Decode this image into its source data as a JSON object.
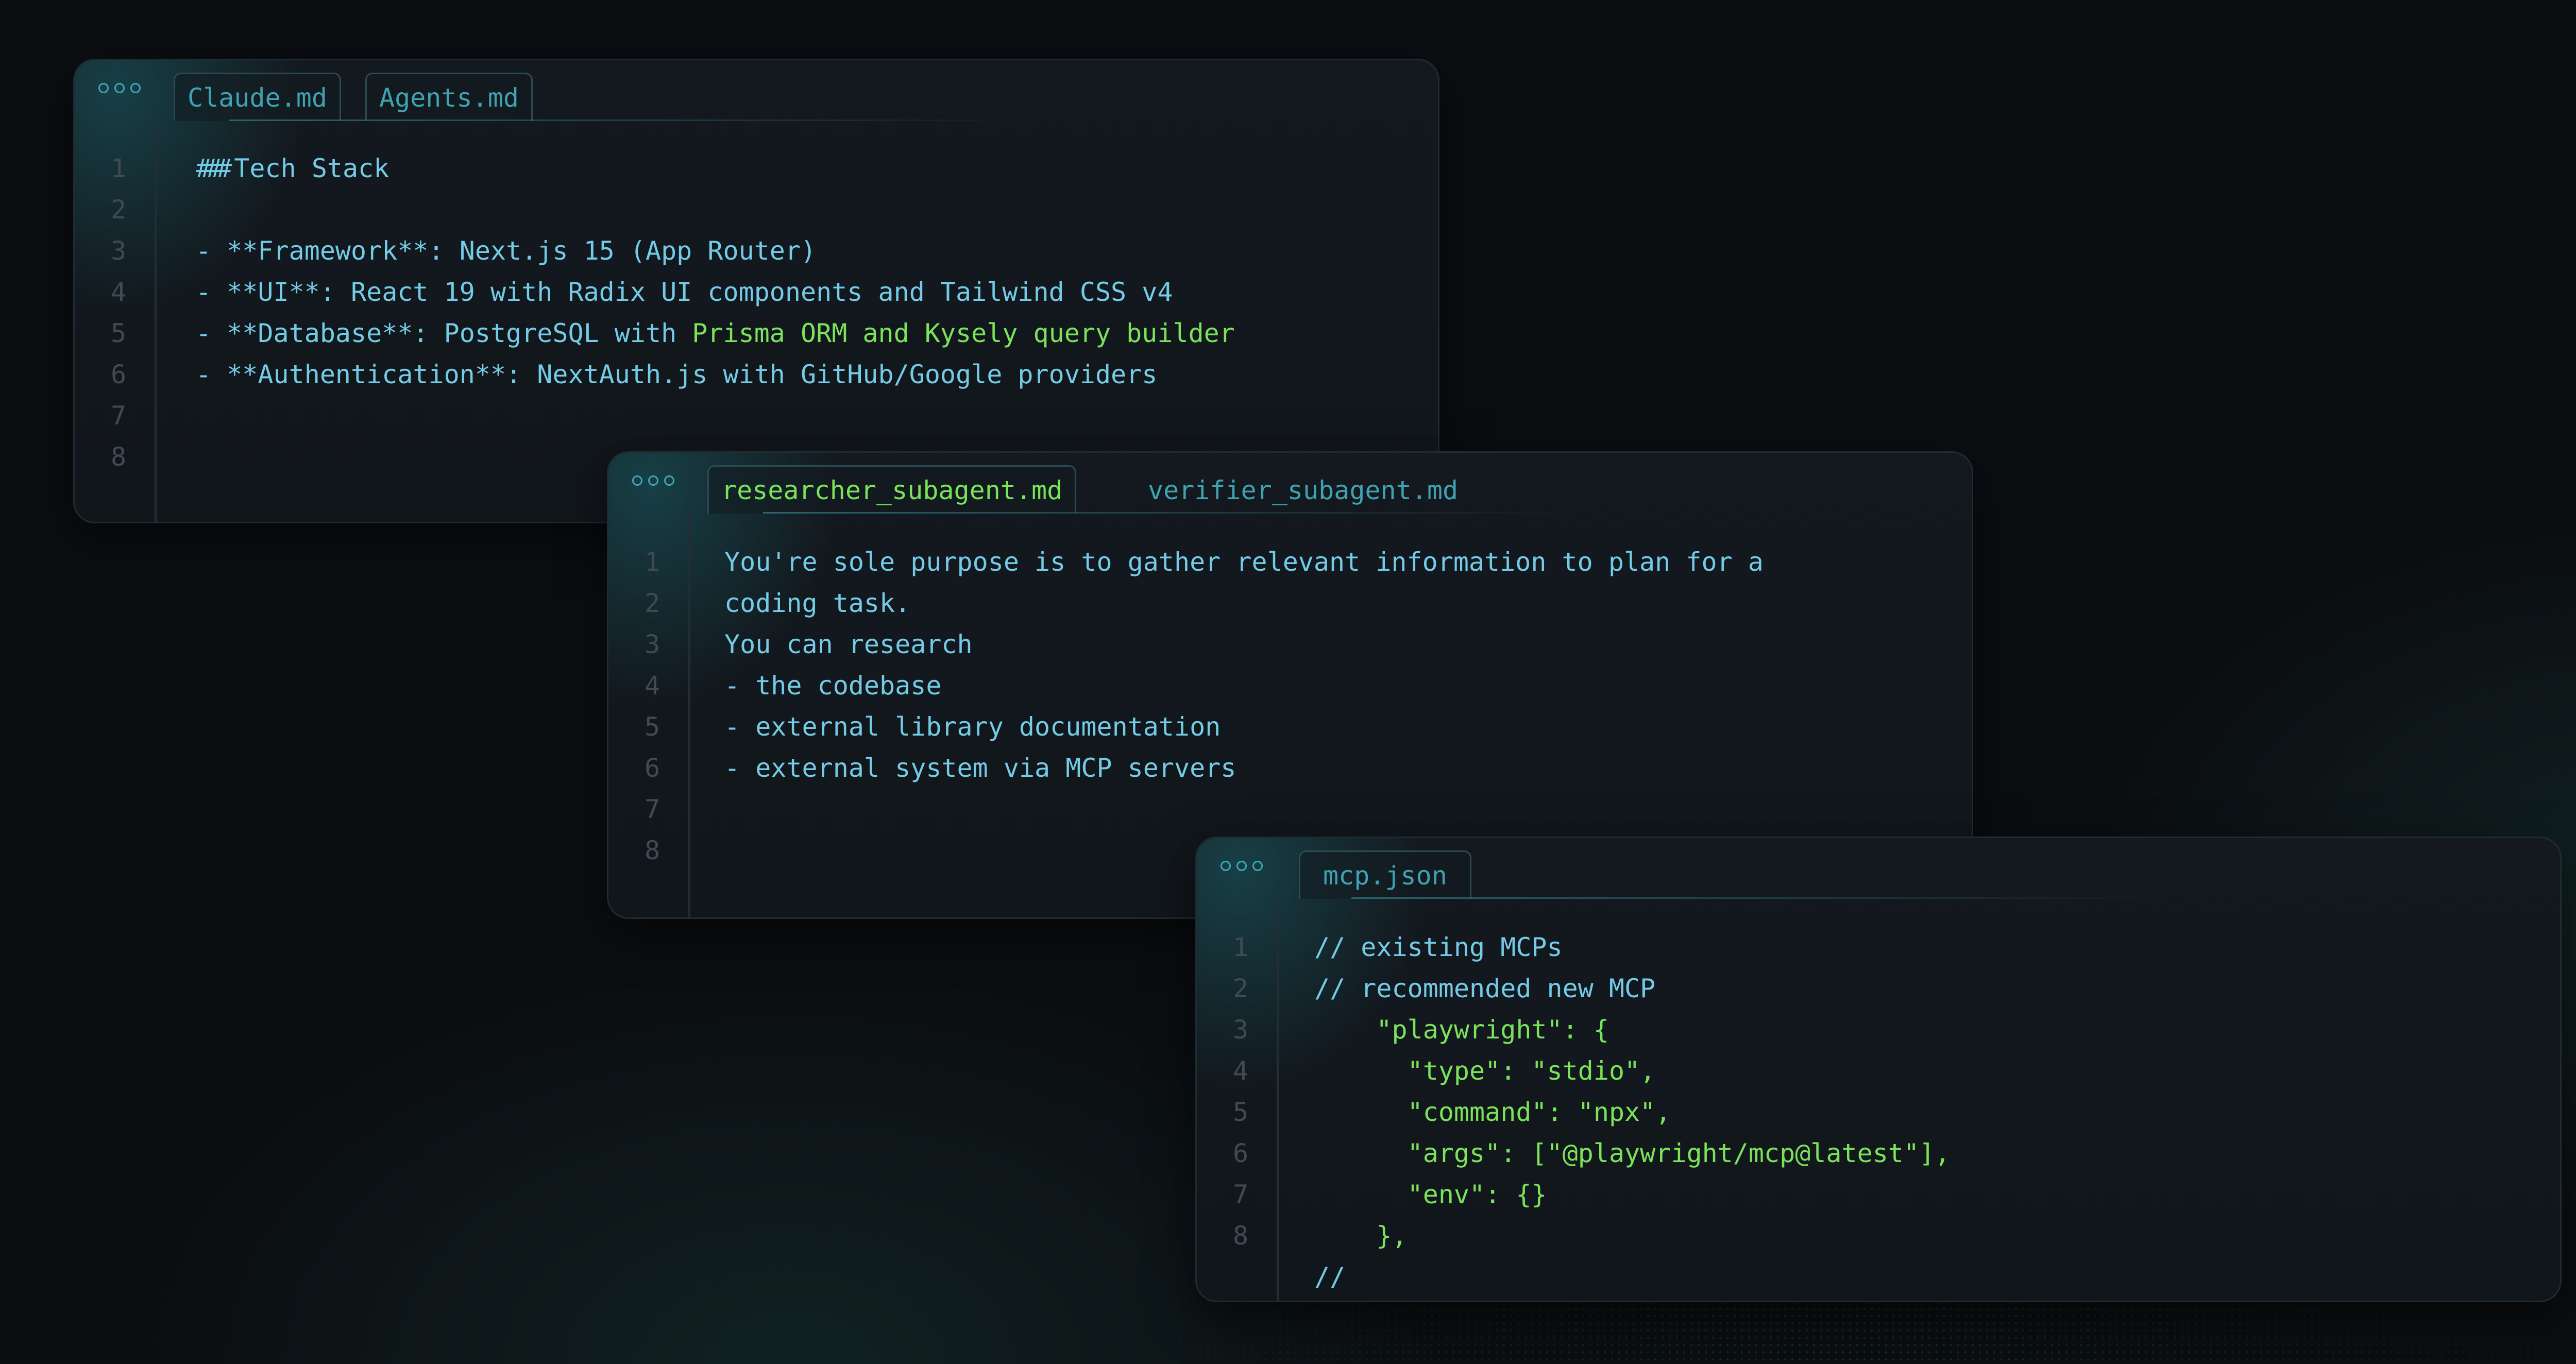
{
  "windows": [
    {
      "tabs": [
        "Claude.md",
        "Agents.md"
      ],
      "line_numbers": [
        "1",
        "2",
        "3",
        "4",
        "5",
        "6",
        "7",
        "8"
      ],
      "lines": [
        {
          "hash": "###",
          "text": "Tech Stack"
        },
        {
          "text": ""
        },
        {
          "text": "- **Framework**: Next.js 15 (App Router)"
        },
        {
          "text": "- **UI**: React 19 with Radix UI components and Tailwind CSS v4"
        },
        {
          "pre": "- **Database**: PostgreSQL with ",
          "green": "Prisma ORM and Kysely query builder"
        },
        {
          "text": "- **Authentication**: NextAuth.js with GitHub/Google providers"
        },
        {
          "text": ""
        },
        {
          "text": ""
        }
      ]
    },
    {
      "tabs": [
        "researcher_subagent.md",
        "verifier_subagent.md"
      ],
      "line_numbers": [
        "1",
        "2",
        "3",
        "4",
        "5",
        "6",
        "7",
        "8"
      ],
      "lines": [
        {
          "text": "You're sole purpose is to gather relevant information to plan for a"
        },
        {
          "text": "coding task."
        },
        {
          "text": "You can research"
        },
        {
          "text": "- the codebase"
        },
        {
          "text": "- external library documentation"
        },
        {
          "text": "- external system via MCP servers"
        },
        {
          "text": ""
        },
        {
          "text": ""
        }
      ]
    },
    {
      "tabs": [
        "mcp.json"
      ],
      "line_numbers": [
        "1",
        "2",
        "3",
        "4",
        "5",
        "6",
        "7",
        "8"
      ],
      "lines": [
        {
          "text": "// existing MCPs"
        },
        {
          "text": "// recommended new MCP"
        },
        {
          "green": "    \"playwright\": {"
        },
        {
          "green": "      \"type\": \"stdio\","
        },
        {
          "green": "      \"command\": \"npx\","
        },
        {
          "green": "      \"args\": [\"@playwright/mcp@latest\"],"
        },
        {
          "green": "      \"env\": {}"
        },
        {
          "green": "    },"
        },
        {
          "text": "//"
        }
      ]
    }
  ],
  "colors": {
    "background": "#0b0e11",
    "text_cyan": "#74cbe6",
    "text_green": "#7ae35a",
    "tab_text": "#3fa2b1"
  }
}
